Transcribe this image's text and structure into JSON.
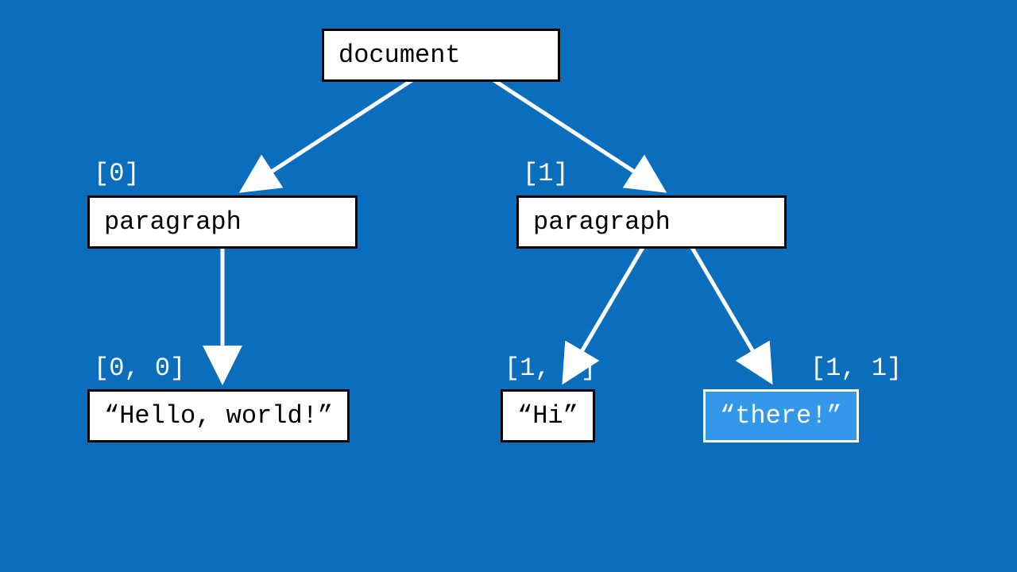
{
  "nodes": {
    "root": {
      "label": "document"
    },
    "p0": {
      "label": "paragraph",
      "path": "[0]"
    },
    "p1": {
      "label": "paragraph",
      "path": "[1]"
    },
    "t00": {
      "label": "“Hello, world!”",
      "path": "[0, 0]"
    },
    "t10": {
      "label": "“Hi”",
      "path": "[1, 0]"
    },
    "t11": {
      "label": "“there!”",
      "path": "[1, 1]"
    }
  }
}
